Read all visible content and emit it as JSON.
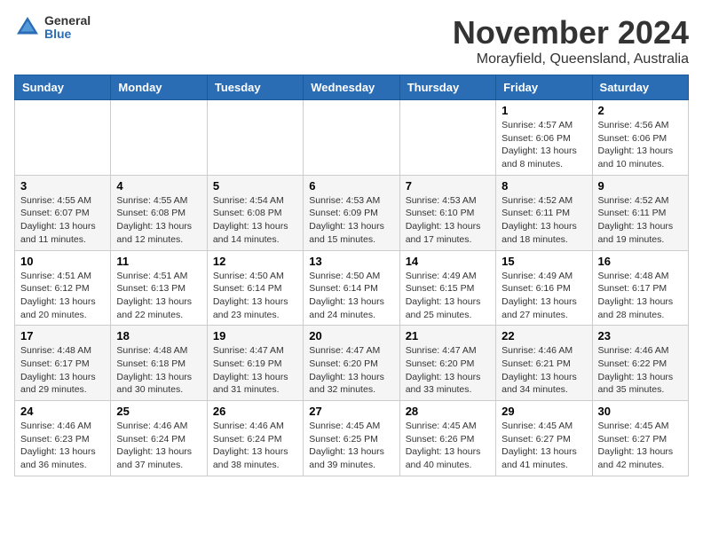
{
  "header": {
    "logo_general": "General",
    "logo_blue": "Blue",
    "month_title": "November 2024",
    "location": "Morayfield, Queensland, Australia"
  },
  "weekdays": [
    "Sunday",
    "Monday",
    "Tuesday",
    "Wednesday",
    "Thursday",
    "Friday",
    "Saturday"
  ],
  "weeks": [
    [
      {
        "day": "",
        "info": ""
      },
      {
        "day": "",
        "info": ""
      },
      {
        "day": "",
        "info": ""
      },
      {
        "day": "",
        "info": ""
      },
      {
        "day": "",
        "info": ""
      },
      {
        "day": "1",
        "info": "Sunrise: 4:57 AM\nSunset: 6:06 PM\nDaylight: 13 hours\nand 8 minutes."
      },
      {
        "day": "2",
        "info": "Sunrise: 4:56 AM\nSunset: 6:06 PM\nDaylight: 13 hours\nand 10 minutes."
      }
    ],
    [
      {
        "day": "3",
        "info": "Sunrise: 4:55 AM\nSunset: 6:07 PM\nDaylight: 13 hours\nand 11 minutes."
      },
      {
        "day": "4",
        "info": "Sunrise: 4:55 AM\nSunset: 6:08 PM\nDaylight: 13 hours\nand 12 minutes."
      },
      {
        "day": "5",
        "info": "Sunrise: 4:54 AM\nSunset: 6:08 PM\nDaylight: 13 hours\nand 14 minutes."
      },
      {
        "day": "6",
        "info": "Sunrise: 4:53 AM\nSunset: 6:09 PM\nDaylight: 13 hours\nand 15 minutes."
      },
      {
        "day": "7",
        "info": "Sunrise: 4:53 AM\nSunset: 6:10 PM\nDaylight: 13 hours\nand 17 minutes."
      },
      {
        "day": "8",
        "info": "Sunrise: 4:52 AM\nSunset: 6:11 PM\nDaylight: 13 hours\nand 18 minutes."
      },
      {
        "day": "9",
        "info": "Sunrise: 4:52 AM\nSunset: 6:11 PM\nDaylight: 13 hours\nand 19 minutes."
      }
    ],
    [
      {
        "day": "10",
        "info": "Sunrise: 4:51 AM\nSunset: 6:12 PM\nDaylight: 13 hours\nand 20 minutes."
      },
      {
        "day": "11",
        "info": "Sunrise: 4:51 AM\nSunset: 6:13 PM\nDaylight: 13 hours\nand 22 minutes."
      },
      {
        "day": "12",
        "info": "Sunrise: 4:50 AM\nSunset: 6:14 PM\nDaylight: 13 hours\nand 23 minutes."
      },
      {
        "day": "13",
        "info": "Sunrise: 4:50 AM\nSunset: 6:14 PM\nDaylight: 13 hours\nand 24 minutes."
      },
      {
        "day": "14",
        "info": "Sunrise: 4:49 AM\nSunset: 6:15 PM\nDaylight: 13 hours\nand 25 minutes."
      },
      {
        "day": "15",
        "info": "Sunrise: 4:49 AM\nSunset: 6:16 PM\nDaylight: 13 hours\nand 27 minutes."
      },
      {
        "day": "16",
        "info": "Sunrise: 4:48 AM\nSunset: 6:17 PM\nDaylight: 13 hours\nand 28 minutes."
      }
    ],
    [
      {
        "day": "17",
        "info": "Sunrise: 4:48 AM\nSunset: 6:17 PM\nDaylight: 13 hours\nand 29 minutes."
      },
      {
        "day": "18",
        "info": "Sunrise: 4:48 AM\nSunset: 6:18 PM\nDaylight: 13 hours\nand 30 minutes."
      },
      {
        "day": "19",
        "info": "Sunrise: 4:47 AM\nSunset: 6:19 PM\nDaylight: 13 hours\nand 31 minutes."
      },
      {
        "day": "20",
        "info": "Sunrise: 4:47 AM\nSunset: 6:20 PM\nDaylight: 13 hours\nand 32 minutes."
      },
      {
        "day": "21",
        "info": "Sunrise: 4:47 AM\nSunset: 6:20 PM\nDaylight: 13 hours\nand 33 minutes."
      },
      {
        "day": "22",
        "info": "Sunrise: 4:46 AM\nSunset: 6:21 PM\nDaylight: 13 hours\nand 34 minutes."
      },
      {
        "day": "23",
        "info": "Sunrise: 4:46 AM\nSunset: 6:22 PM\nDaylight: 13 hours\nand 35 minutes."
      }
    ],
    [
      {
        "day": "24",
        "info": "Sunrise: 4:46 AM\nSunset: 6:23 PM\nDaylight: 13 hours\nand 36 minutes."
      },
      {
        "day": "25",
        "info": "Sunrise: 4:46 AM\nSunset: 6:24 PM\nDaylight: 13 hours\nand 37 minutes."
      },
      {
        "day": "26",
        "info": "Sunrise: 4:46 AM\nSunset: 6:24 PM\nDaylight: 13 hours\nand 38 minutes."
      },
      {
        "day": "27",
        "info": "Sunrise: 4:45 AM\nSunset: 6:25 PM\nDaylight: 13 hours\nand 39 minutes."
      },
      {
        "day": "28",
        "info": "Sunrise: 4:45 AM\nSunset: 6:26 PM\nDaylight: 13 hours\nand 40 minutes."
      },
      {
        "day": "29",
        "info": "Sunrise: 4:45 AM\nSunset: 6:27 PM\nDaylight: 13 hours\nand 41 minutes."
      },
      {
        "day": "30",
        "info": "Sunrise: 4:45 AM\nSunset: 6:27 PM\nDaylight: 13 hours\nand 42 minutes."
      }
    ]
  ]
}
